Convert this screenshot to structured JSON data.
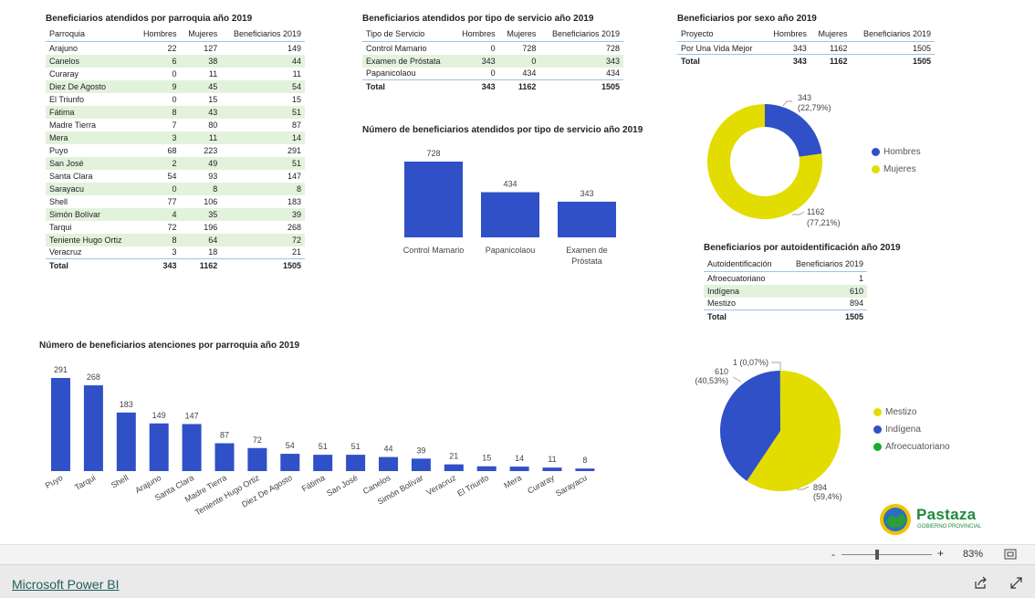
{
  "parroquia_table": {
    "title": "Beneficiarios atendidos por parroquia año 2019",
    "headers": [
      "Parroquia",
      "Hombres",
      "Mujeres",
      "Beneficiarios 2019"
    ],
    "rows": [
      [
        "Arajuno",
        "22",
        "127",
        "149"
      ],
      [
        "Canelos",
        "6",
        "38",
        "44"
      ],
      [
        "Curaray",
        "0",
        "11",
        "11"
      ],
      [
        "Diez De Agosto",
        "9",
        "45",
        "54"
      ],
      [
        "El Triunfo",
        "0",
        "15",
        "15"
      ],
      [
        "Fátima",
        "8",
        "43",
        "51"
      ],
      [
        "Madre Tierra",
        "7",
        "80",
        "87"
      ],
      [
        "Mera",
        "3",
        "11",
        "14"
      ],
      [
        "Puyo",
        "68",
        "223",
        "291"
      ],
      [
        "San José",
        "2",
        "49",
        "51"
      ],
      [
        "Santa Clara",
        "54",
        "93",
        "147"
      ],
      [
        "Sarayacu",
        "0",
        "8",
        "8"
      ],
      [
        "Shell",
        "77",
        "106",
        "183"
      ],
      [
        "Simón Bolívar",
        "4",
        "35",
        "39"
      ],
      [
        "Tarqui",
        "72",
        "196",
        "268"
      ],
      [
        "Teniente Hugo Ortiz",
        "8",
        "64",
        "72"
      ],
      [
        "Veracruz",
        "3",
        "18",
        "21"
      ]
    ],
    "total": [
      "Total",
      "343",
      "1162",
      "1505"
    ]
  },
  "servicio_table": {
    "title": "Beneficiarios atendidos por tipo de servicio año 2019",
    "headers": [
      "Tipo de Servicio",
      "Hombres",
      "Mujeres",
      "Beneficiarios 2019"
    ],
    "rows": [
      [
        "Control Mamario",
        "0",
        "728",
        "728"
      ],
      [
        "Examen de Próstata",
        "343",
        "0",
        "343"
      ],
      [
        "Papanicolaou",
        "0",
        "434",
        "434"
      ]
    ],
    "total": [
      "Total",
      "343",
      "1162",
      "1505"
    ]
  },
  "sexo_table": {
    "title": "Beneficiarios por sexo año 2019",
    "headers": [
      "Proyecto",
      "Hombres",
      "Mujeres",
      "Beneficiarios 2019"
    ],
    "rows": [
      [
        "Por Una Vida Mejor",
        "343",
        "1162",
        "1505"
      ]
    ],
    "total": [
      "Total",
      "343",
      "1162",
      "1505"
    ]
  },
  "autoid_table": {
    "title": "Beneficiarios por autoidentificación año 2019",
    "headers": [
      "Autoidentificación",
      "Beneficiarios 2019"
    ],
    "rows": [
      [
        "Afroecuatoriano",
        "1"
      ],
      [
        "Indígena",
        "610"
      ],
      [
        "Mestizo",
        "894"
      ]
    ],
    "total": [
      "Total",
      "1505"
    ]
  },
  "colors": {
    "blue": "#3050c8",
    "yellow": "#e2dc00",
    "green": "#1aab2b",
    "table_alt": "#e3f2dc"
  },
  "chart_data": [
    {
      "type": "bar",
      "title": "Número de beneficiarios atendidos por tipo de servicio año 2019",
      "categories": [
        "Control Mamario",
        "Papanicolaou",
        "Examen de Próstata"
      ],
      "values": [
        728,
        434,
        343
      ],
      "ylim": [
        0,
        728
      ]
    },
    {
      "type": "bar",
      "title": "Número de beneficiarios atenciones por parroquia año 2019",
      "categories": [
        "Puyo",
        "Tarqui",
        "Shell",
        "Arajuno",
        "Santa Clara",
        "Madre Tierra",
        "Teniente Hugo Ortiz",
        "Diez De Agosto",
        "Fátima",
        "San José",
        "Canelos",
        "Simón Bolívar",
        "Veracruz",
        "El Triunfo",
        "Mera",
        "Curaray",
        "Sarayacu"
      ],
      "values": [
        291,
        268,
        183,
        149,
        147,
        87,
        72,
        54,
        51,
        51,
        44,
        39,
        21,
        15,
        14,
        11,
        8
      ],
      "ylim": [
        0,
        291
      ]
    },
    {
      "type": "pie",
      "subtype": "donut",
      "title": "Beneficiarios por sexo año 2019",
      "categories": [
        "Hombres",
        "Mujeres"
      ],
      "values": [
        343,
        1162
      ],
      "labels": [
        "343\n(22,79%)",
        "1162\n(77,21%)"
      ],
      "legend": "right"
    },
    {
      "type": "pie",
      "title": "Beneficiarios por autoidentificación año 2019",
      "categories": [
        "Mestizo",
        "Indígena",
        "Afroecuatoriano"
      ],
      "values": [
        894,
        610,
        1
      ],
      "labels": [
        "894\n(59,4%)",
        "610\n(40,53%)",
        "1 (0,07%)"
      ],
      "legend": "right"
    }
  ],
  "logo": {
    "name": "Pastaza",
    "subtitle": "GOBIERNO PROVINCIAL"
  },
  "zoom": {
    "minus": "-",
    "plus": "+",
    "level": "83%"
  },
  "footer": {
    "link": "Microsoft Power BI"
  }
}
